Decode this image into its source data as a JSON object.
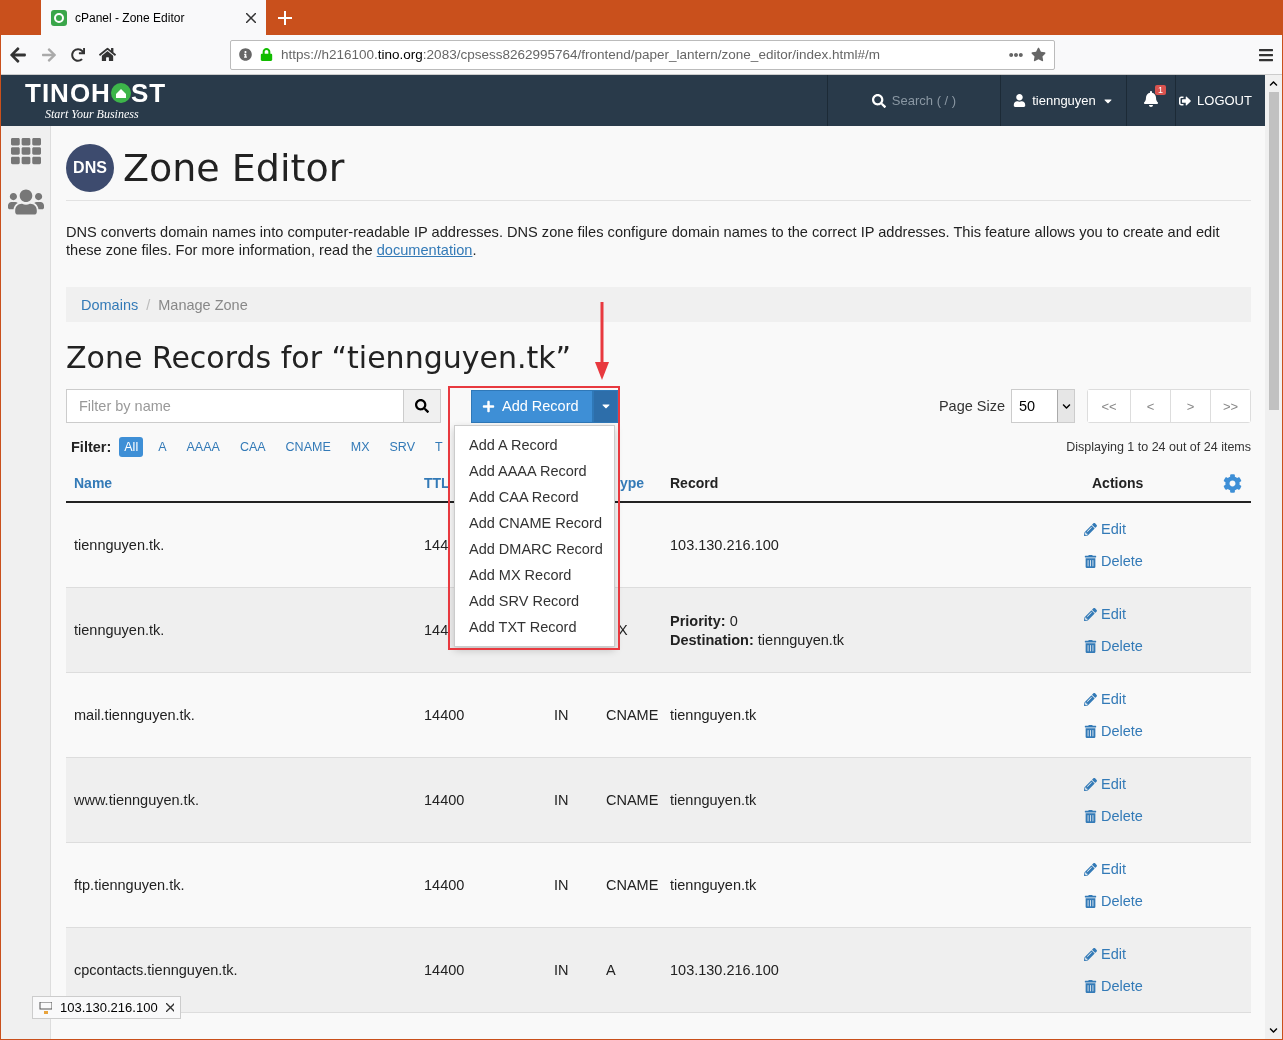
{
  "browser": {
    "tab": {
      "title": "cPanel - Zone Editor"
    },
    "address": {
      "prefix": "https://h216100.",
      "domain": "tino.org",
      "rest": ":2083/cpsess8262995764/frontend/paper_lantern/zone_editor/index.html#/m"
    }
  },
  "header": {
    "logo": "TINOH",
    "logo_end": "ST",
    "tagline": "Start Your Business",
    "search": {
      "placeholder": "Search ( / )"
    },
    "user": "tiennguyen",
    "notifications": "1",
    "logout": "LOGOUT"
  },
  "page": {
    "title": "Zone Editor",
    "icon_text": "DNS",
    "description": "DNS converts domain names into computer-readable IP addresses. DNS zone files configure domain names to the correct IP addresses. This feature allows you to create and edit these zone files. For more information, read the ",
    "link": "documentation",
    "description_end": "."
  },
  "breadcrumb": {
    "separator": "/",
    "items": [
      {
        "label": "Domains",
        "link": true
      },
      {
        "label": "Manage Zone",
        "link": false
      }
    ]
  },
  "heading": "Zone Records for “tiennguyen.tk”",
  "filter_field": {
    "placeholder": "Filter by name"
  },
  "add_record": {
    "label": "Add Record",
    "menu_open": true,
    "menu": [
      "Add A Record",
      "Add AAAA Record",
      "Add CAA Record",
      "Add CNAME Record",
      "Add DMARC Record",
      "Add MX Record",
      "Add SRV Record",
      "Add TXT Record"
    ]
  },
  "page_size": {
    "label": "Page Size",
    "value": "50"
  },
  "pager": [
    "<<",
    "<",
    ">",
    ">>"
  ],
  "display_info": "Displaying 1 to 24 out of 24 items",
  "filter": {
    "label": "Filter:",
    "options": [
      {
        "label": "All",
        "selected": true
      },
      {
        "label": "A",
        "selected": false
      },
      {
        "label": "AAAA",
        "selected": false
      },
      {
        "label": "CAA",
        "selected": false
      },
      {
        "label": "CNAME",
        "selected": false
      },
      {
        "label": "MX",
        "selected": false
      },
      {
        "label": "SRV",
        "selected": false
      },
      {
        "label": "T",
        "selected": false
      }
    ]
  },
  "table": {
    "columns": [
      {
        "label": "Name",
        "link": true
      },
      {
        "label": "TTL",
        "link": true
      },
      {
        "label": "ype",
        "link": true
      },
      {
        "label": "Record",
        "link": false
      },
      {
        "label": "Actions",
        "link": false
      }
    ],
    "rows": [
      {
        "name": "tiennguyen.tk.",
        "ttl": "144",
        "record": [
          {
            "text": "103.130.216.100"
          }
        ],
        "actions": [
          "Edit",
          "Delete"
        ]
      },
      {
        "name": "tiennguyen.tk.",
        "ttl": "144",
        "type": "X",
        "record": [
          {
            "label": "Priority:",
            "text": "0"
          },
          {
            "label": "Destination:",
            "text": "tiennguyen.tk"
          }
        ],
        "actions": [
          "Edit",
          "Delete"
        ]
      },
      {
        "name": "mail.tiennguyen.tk.",
        "ttl": "14400",
        "class": "IN",
        "type": "CNAME",
        "record": [
          {
            "text": "tiennguyen.tk"
          }
        ],
        "actions": [
          "Edit",
          "Delete"
        ]
      },
      {
        "name": "www.tiennguyen.tk.",
        "ttl": "14400",
        "class": "IN",
        "type": "CNAME",
        "record": [
          {
            "text": "tiennguyen.tk"
          }
        ],
        "actions": [
          "Edit",
          "Delete"
        ]
      },
      {
        "name": "ftp.tiennguyen.tk.",
        "ttl": "14400",
        "class": "IN",
        "type": "CNAME",
        "record": [
          {
            "text": "tiennguyen.tk"
          }
        ],
        "actions": [
          "Edit",
          "Delete"
        ]
      },
      {
        "name": "cpcontacts.tiennguyen.tk.",
        "ttl": "14400",
        "class": "IN",
        "type": "A",
        "record": [
          {
            "text": "103.130.216.100"
          }
        ],
        "actions": [
          "Edit",
          "Delete"
        ]
      }
    ]
  },
  "status_popup": {
    "text": "103.130.216.100"
  }
}
